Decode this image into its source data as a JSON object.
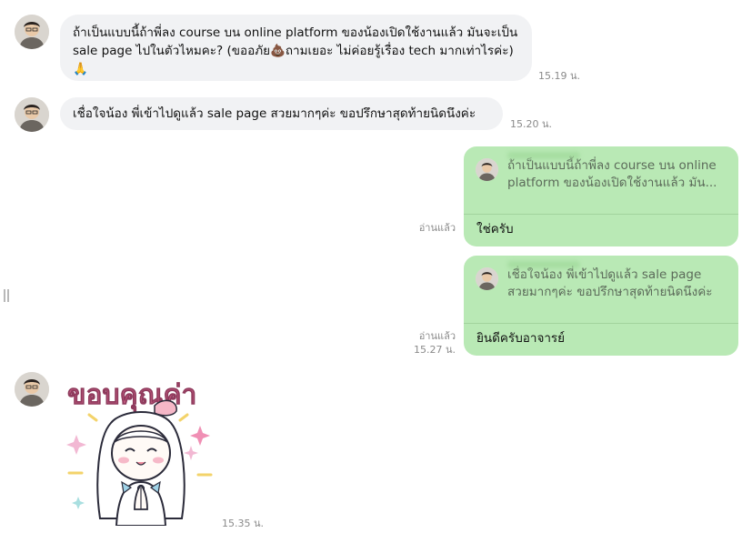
{
  "messages": {
    "m1": {
      "text": "ถ้าเป็นแบบนี้ถ้าพี่ลง course บน online platform ของน้องเปิดใช้งานแล้ว มันจะเป็น sale page ไปในตัวไหมคะ? (ขออภัย💩ถามเยอะ ไม่ค่อยรู้เรื่อง tech มากเท่าไรค่ะ)🙏",
      "time": "15.19 น."
    },
    "m2": {
      "text": "เชื่อใจน้อง พี่เข้าไปดูแล้ว sale page สวยมากๆค่ะ ขอปรึกษาสุดท้ายนิดนึงค่ะ",
      "time": "15.20 น."
    },
    "r1": {
      "quote": "ถ้าเป็นแบบนี้ถ้าพี่ลง course บน online platform ของน้องเปิดใช้งานแล้ว มัน...",
      "text": "ใช่ครับ",
      "read": "อ่านแล้ว"
    },
    "r2": {
      "quote": "เชื่อใจน้อง พี่เข้าไปดูแล้ว sale page สวยมากๆค่ะ ขอปรึกษาสุดท้ายนิดนึงค่ะ",
      "text": "ยินดีครับอาจารย์",
      "read": "อ่านแล้ว",
      "time": "15.27 น."
    },
    "sticker": {
      "caption": "ขอบคุณค่า",
      "time": "15.35 น."
    }
  },
  "colors": {
    "incoming_bubble": "#f1f2f4",
    "outgoing_bubble": "#b9e9b5",
    "sticker_text": "#c0587e"
  }
}
